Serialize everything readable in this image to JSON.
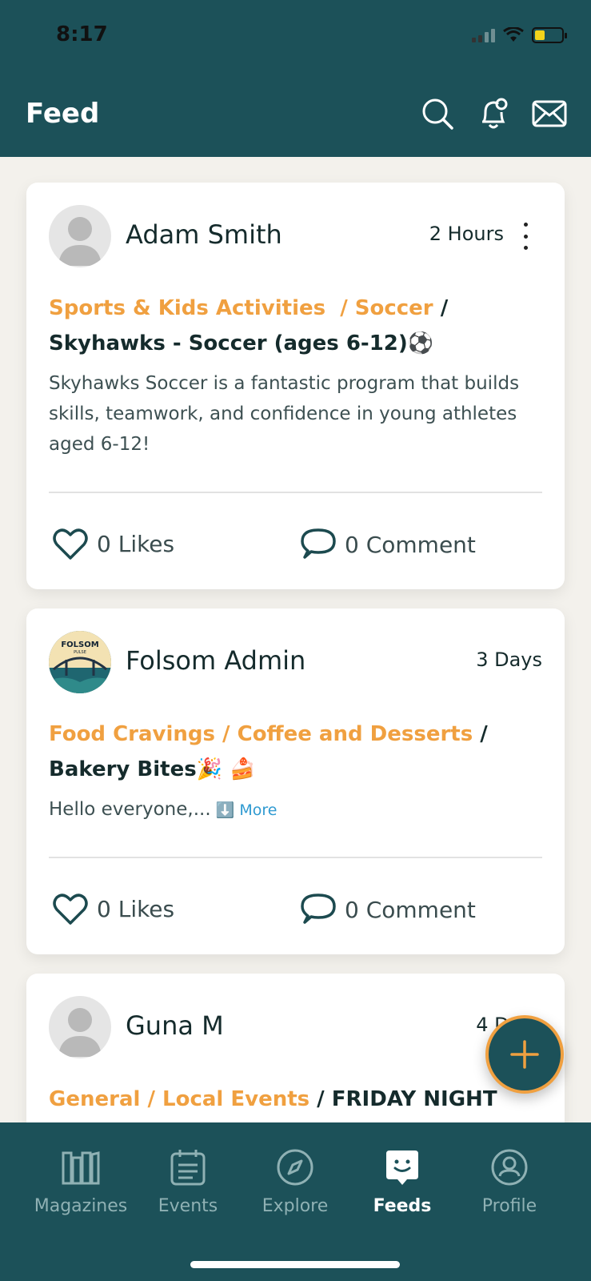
{
  "status_bar": {
    "time": "8:17"
  },
  "header": {
    "title": "Feed"
  },
  "posts": [
    {
      "author": "Adam Smith",
      "time": "2 Hours",
      "category": "Sports & Kids Activities",
      "subcategory": "Soccer",
      "title": "Skyhawks - Soccer (ages 6-12)⚽",
      "description": "Skyhawks Soccer is a fantastic program that builds skills, teamwork, and confidence in young athletes aged 6-12!",
      "likes": "0 Likes",
      "comments": "0 Comment"
    },
    {
      "author": "Folsom Admin",
      "time": "3 Days",
      "category": "Food Cravings",
      "subcategory": "Coffee and  Desserts",
      "title": "Bakery Bites🎉 🍰",
      "description": "Hello everyone,...",
      "more_label": "⬇️ More",
      "likes": "0 Likes",
      "comments": "0 Comment",
      "avatar_text": "FOLSOM",
      "avatar_subtext": "PULSE"
    },
    {
      "author": "Guna M",
      "time": "4 Days",
      "category": "General",
      "subcategory": "Local Events",
      "title": "FRIDAY NIGHT"
    }
  ],
  "separators": {
    "slash": " / "
  },
  "bottom_nav": [
    {
      "label": "Magazines",
      "icon": "magazines-icon"
    },
    {
      "label": "Events",
      "icon": "calendar-icon"
    },
    {
      "label": "Explore",
      "icon": "compass-icon"
    },
    {
      "label": "Feeds",
      "icon": "feeds-icon",
      "active": true
    },
    {
      "label": "Profile",
      "icon": "profile-icon"
    }
  ],
  "colors": {
    "primary": "#1c5159",
    "accent": "#f0a040",
    "link": "#2f9ad1"
  }
}
